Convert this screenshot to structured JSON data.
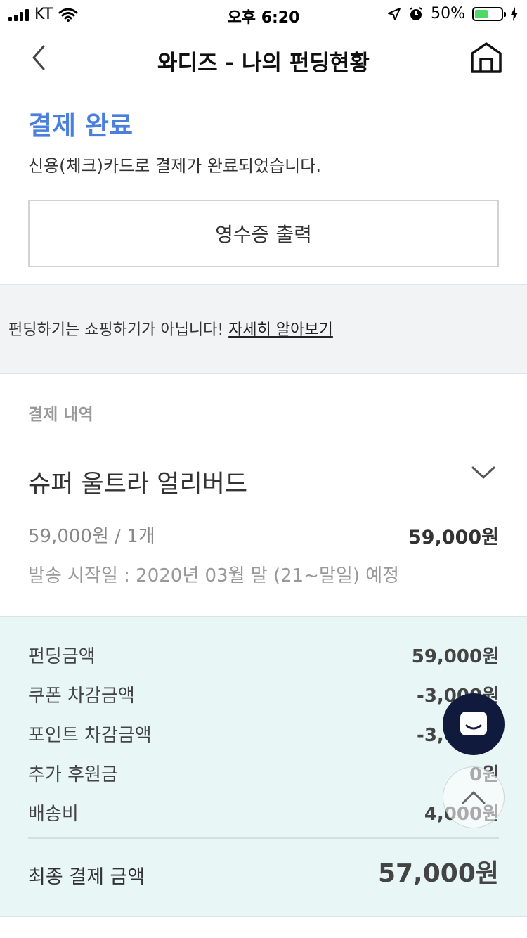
{
  "status_bar": {
    "carrier": "KT",
    "time": "오후 6:20",
    "battery_percent": "50%",
    "battery_level": 0.5
  },
  "nav": {
    "title": "와디즈 - 나의 펀딩현황"
  },
  "payment_status": {
    "title": "결제 완료",
    "description": "신용(체크)카드로 결제가 완료되었습니다.",
    "receipt_button": "영수증 출력"
  },
  "notice": {
    "text": "펀딩하기는 쇼핑하기가 아닙니다! ",
    "link": "자세히 알아보기"
  },
  "payment_details": {
    "section_label": "결제 내역",
    "product_name": "슈퍼 울트라 얼리버드",
    "unit_price_qty": "59,000원 / 1개",
    "line_total": "59,000원",
    "ship_start": "발송 시작일 : 2020년 03월 말 (21~말일) 예정"
  },
  "summary": {
    "rows": [
      {
        "label": "펀딩금액",
        "value": "59,000원"
      },
      {
        "label": "쿠폰 차감금액",
        "value": "-3,000원"
      },
      {
        "label": "포인트 차감금액",
        "value": "-3,000원"
      },
      {
        "label": "추가 후원금",
        "value": "0원"
      },
      {
        "label": "배송비",
        "value": "4,000원"
      }
    ],
    "final_label": "최종 결제 금액",
    "final_value": "57,000원"
  },
  "colors": {
    "accent": "#4a7fdc",
    "summary_bg": "#e8f6f6",
    "chat_button": "#0f1a3c",
    "battery_fill": "#4cd964"
  },
  "icons": {
    "back": "chevron-left-icon",
    "home": "home-icon",
    "toggle": "chevron-down-icon",
    "chat": "chat-icon",
    "scroll_top": "chevron-up-icon"
  }
}
